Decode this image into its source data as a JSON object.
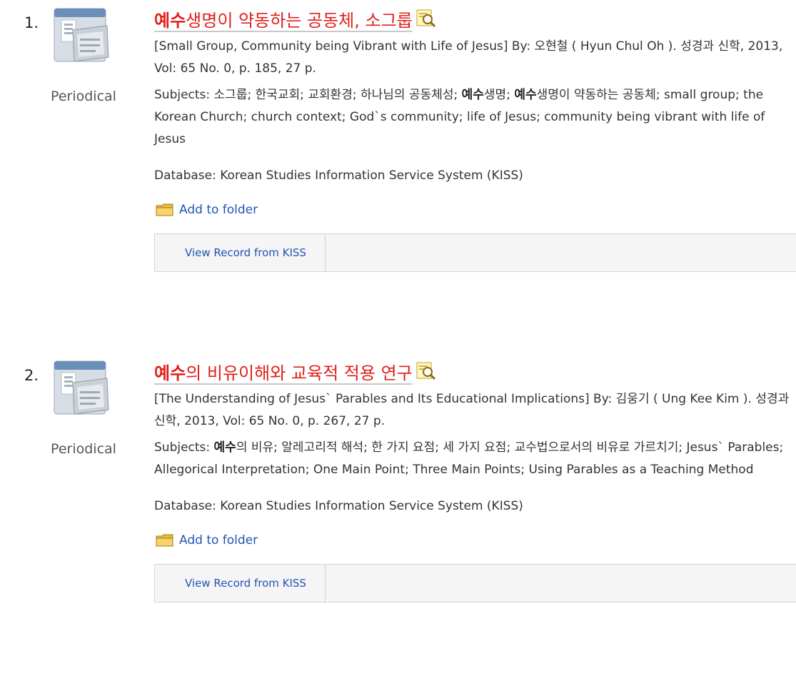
{
  "results": [
    {
      "number": "1.",
      "type": "Periodical",
      "title_highlight": "예수",
      "title_rest": "생명이 약동하는 공동체, 소그룹",
      "citation": "[Small Group, Community being Vibrant with Life of Jesus] By: 오현철 ( Hyun Chul Oh ). 성경과 신학, 2013, Vol: 65 No. 0, p. 185, 27 p.",
      "subjects_prefix": "Subjects: 소그룹; 한국교회; 교회환경; 하나님의 공동체성; ",
      "subjects_hl1": "예수",
      "subjects_mid": "생명; ",
      "subjects_hl2": "예수",
      "subjects_rest": "생명이 약동하는 공동체; small group; the Korean Church; church context; God`s community; life of Jesus; community being vibrant with life of Jesus",
      "database": "Database: Korean Studies Information Service System (KISS)",
      "add_to_folder": "Add to folder",
      "view_record": "View Record from KISS"
    },
    {
      "number": "2.",
      "type": "Periodical",
      "title_highlight": "예수",
      "title_rest": "의 비유이해와 교육적 적용 연구",
      "citation": "[The Understanding of Jesus` Parables and Its Educational Implications] By: 김웅기 ( Ung Kee Kim ). 성경과 신학, 2013, Vol: 65 No. 0, p. 267, 27 p.",
      "subjects_prefix": "Subjects: ",
      "subjects_hl1": "예수",
      "subjects_rest": "의 비유; 알레고리적 해석; 한 가지 요점; 세 가지 요점; 교수법으로서의 비유로 가르치기; Jesus` Parables; Allegorical Interpretation; One Main Point; Three Main Points; Using Parables as a Teaching Method",
      "database": "Database: Korean Studies Information Service System (KISS)",
      "add_to_folder": "Add to folder",
      "view_record": "View Record from KISS"
    }
  ],
  "icons": {
    "thumbnail": "periodical-icon",
    "preview": "magnifier-preview-icon",
    "folder": "folder-icon"
  },
  "colors": {
    "title": "#e0201b",
    "link": "#2154b3",
    "bar_bg": "#f5f5f5"
  }
}
